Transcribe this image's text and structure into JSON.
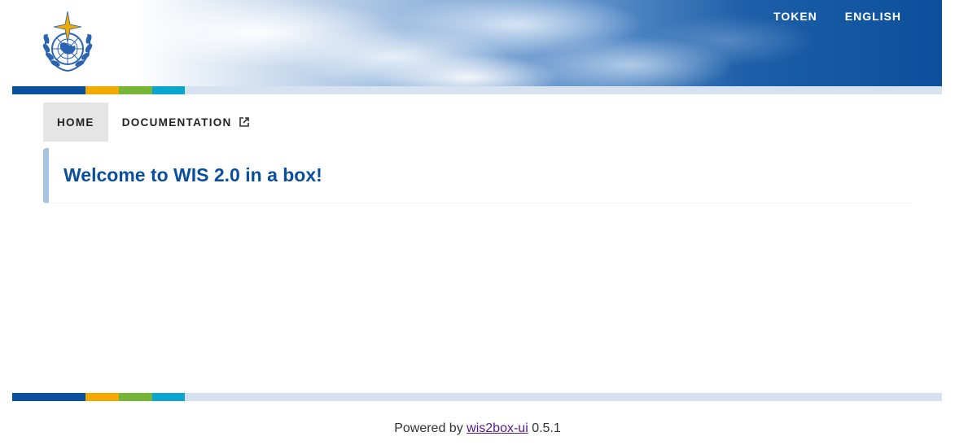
{
  "header": {
    "logo_icon": "wmo-emblem-icon",
    "nav": [
      {
        "label": "TOKEN"
      },
      {
        "label": "ENGLISH"
      }
    ]
  },
  "colors": {
    "brand_blue": "#0a4f9e",
    "strip": [
      "#0a4f9e",
      "#f2a900",
      "#76b536",
      "#0ba5cf",
      "#d6e2f0"
    ],
    "card_accent": "#a6c3e2",
    "active_tab_bg": "#e5e5e5"
  },
  "tabs": [
    {
      "label": "HOME",
      "active": true
    },
    {
      "label": "DOCUMENTATION",
      "icon": "external-link-icon",
      "active": false
    }
  ],
  "main": {
    "title": "Welcome to WIS 2.0 in a box!"
  },
  "footer": {
    "prefix": "Powered by",
    "link_text": "wis2box-ui",
    "version": "0.5.1"
  }
}
